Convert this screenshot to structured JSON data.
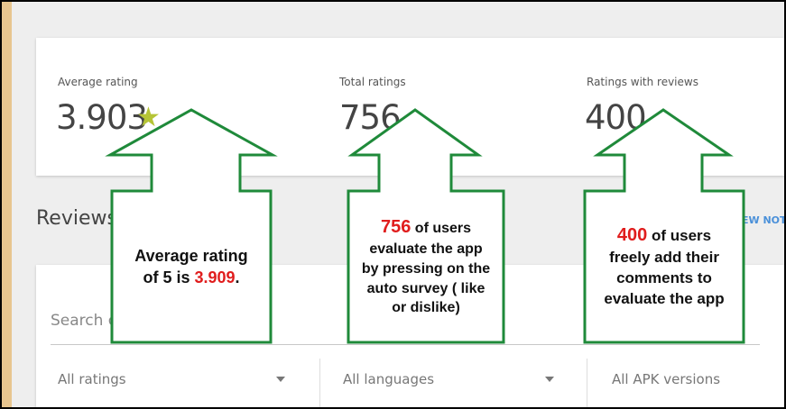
{
  "stats": {
    "average": {
      "label": "Average rating",
      "value": "3.903"
    },
    "total": {
      "label": "Total ratings",
      "value": "756"
    },
    "with_reviews": {
      "label": "Ratings with reviews",
      "value": "400"
    }
  },
  "reviews": {
    "heading": "Reviews",
    "new_notice_link": "EW NOTI",
    "search_placeholder": "Search or",
    "filters": [
      {
        "label": "All ratings"
      },
      {
        "label": "All languages"
      },
      {
        "label": "All APK versions"
      }
    ]
  },
  "callouts": {
    "average": {
      "line1": "Average rating",
      "line2_prefix": "of 5 is ",
      "line2_highlight": "3.909",
      "line2_suffix": "."
    },
    "total": {
      "highlight": "756",
      "line1_rest": " of users",
      "line2": "evaluate the app",
      "line3": "by pressing on the",
      "line4": "auto survey ( like",
      "line5": "or dislike)"
    },
    "reviews": {
      "highlight": "400",
      "line1_rest": " of users",
      "line2": "freely add their",
      "line3": "comments to",
      "line4": "evaluate the app"
    }
  },
  "colors": {
    "callout_border": "#1f8a3a",
    "highlight": "#e01d1d",
    "star": "#b5c436",
    "link": "#4a90d9"
  },
  "icons": {
    "rating_star": "★",
    "dropdown": "caret-down"
  }
}
